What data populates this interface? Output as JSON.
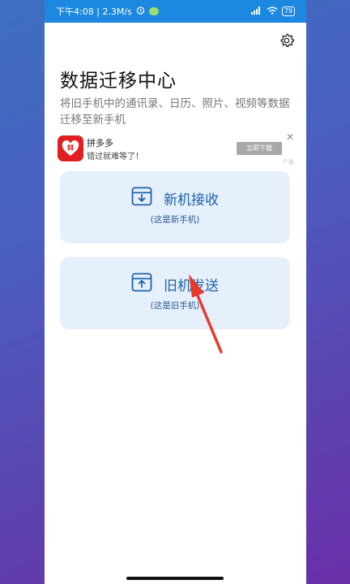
{
  "status_bar": {
    "time_speed": "下午4:08 | 2.3M/s",
    "battery": "79"
  },
  "header": {
    "title": "数据迁移中心",
    "subtitle": "将旧手机中的通讯录、日历、照片、视频等数据迁移至新手机"
  },
  "ad": {
    "app_name": "拼多多",
    "slogan": "错过就难等了！",
    "button_label": "立即下载",
    "close": "✕",
    "tag": "广告"
  },
  "cards": {
    "receive": {
      "label": "新机接收",
      "hint": "(这是新手机)"
    },
    "send": {
      "label": "旧机发送",
      "hint": "(这是旧手机)"
    }
  },
  "colors": {
    "statusbar": "#1d88e0",
    "card_bg": "#e6f0fc",
    "accent": "#1e62a8",
    "arrow": "#e83a2a"
  }
}
